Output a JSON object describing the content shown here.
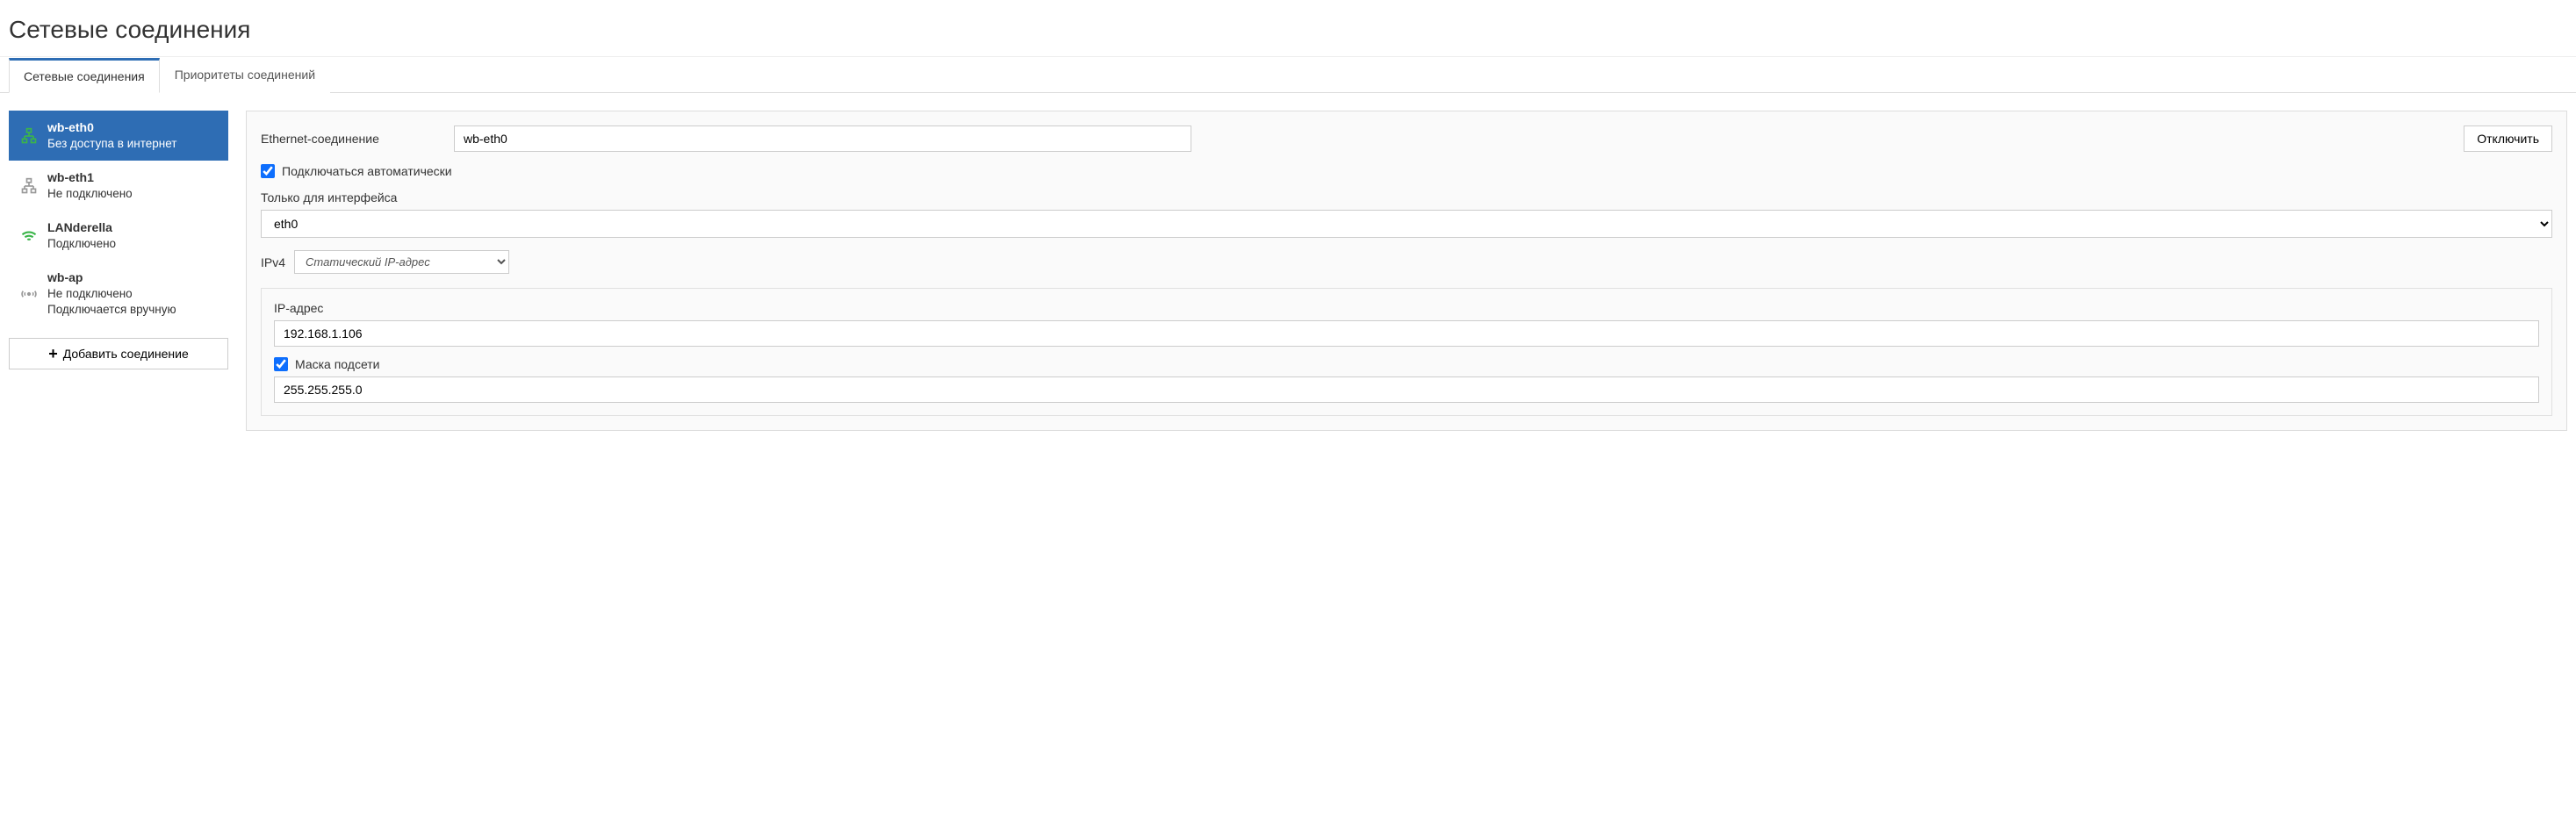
{
  "page": {
    "title": "Сетевые соединения"
  },
  "tabs": [
    {
      "label": "Сетевые соединения",
      "active": true
    },
    {
      "label": "Приоритеты соединений",
      "active": false
    }
  ],
  "sidebar": {
    "items": [
      {
        "title": "wb-eth0",
        "status": "Без доступа в интернет",
        "icon": "ethernet",
        "icon_color": "#3bb54a",
        "active": true
      },
      {
        "title": "wb-eth1",
        "status": "Не подключено",
        "icon": "ethernet",
        "icon_color": "#999",
        "active": false
      },
      {
        "title": "LANderella",
        "status": "Подключено",
        "icon": "wifi",
        "icon_color": "#3bb54a",
        "active": false
      },
      {
        "title": "wb-ap",
        "status": "Не подключено",
        "status2": "Подключается вручную",
        "icon": "antenna",
        "icon_color": "#999",
        "active": false
      }
    ],
    "add_button_label": "Добавить соединение"
  },
  "form": {
    "connection_type_label": "Ethernet-соединение",
    "connection_name_value": "wb-eth0",
    "disconnect_button": "Отключить",
    "auto_connect_label": "Подключаться автоматически",
    "auto_connect_checked": true,
    "interface_only_label": "Только для интерфейса",
    "interface_value": "eth0",
    "ipv4_label": "IPv4",
    "ipv4_mode_value": "Статический IP-адрес",
    "ip_address_label": "IP-адрес",
    "ip_address_value": "192.168.1.106",
    "subnet_mask_label": "Маска подсети",
    "subnet_mask_checked": true,
    "subnet_mask_value": "255.255.255.0"
  }
}
